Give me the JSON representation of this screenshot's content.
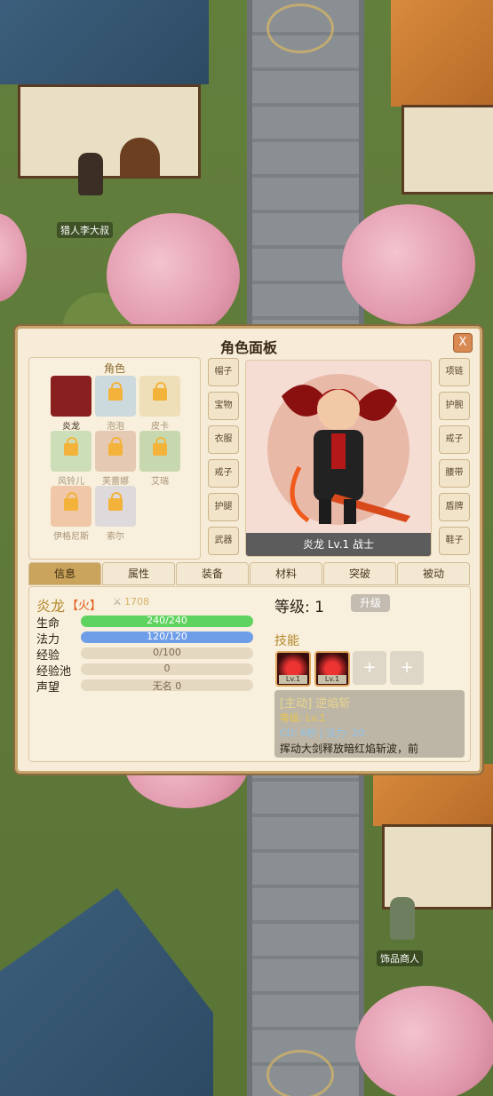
{
  "npcs": {
    "hunter": "猎人李大叔",
    "merchant": "饰品商人"
  },
  "panel": {
    "title": "角色面板",
    "close_label": "X",
    "roster": {
      "title": "角色",
      "heroes": [
        {
          "name": "炎龙",
          "locked": false,
          "color": "#8a1f1f"
        },
        {
          "name": "泡泡",
          "locked": true,
          "color": "#a9c9df"
        },
        {
          "name": "皮卡",
          "locked": true,
          "color": "#e7d19b"
        },
        {
          "name": "风铃儿",
          "locked": true,
          "color": "#a7cf9b"
        },
        {
          "name": "芙蕾娜",
          "locked": true,
          "color": "#d7a98f"
        },
        {
          "name": "艾瑞",
          "locked": true,
          "color": "#9fc48a"
        },
        {
          "name": "伊格尼斯",
          "locked": true,
          "color": "#e9a77b"
        },
        {
          "name": "索尔",
          "locked": true,
          "color": "#c9c7d9"
        }
      ]
    },
    "left_slots": [
      "帽子",
      "宝物",
      "衣服",
      "戒子",
      "护腿",
      "武器"
    ],
    "right_slots": [
      "项链",
      "护腕",
      "戒子",
      "腰带",
      "盾牌",
      "鞋子"
    ],
    "portrait": {
      "name_bar": "炎龙  Lv.1 战士"
    },
    "tabs": [
      "信息",
      "属性",
      "装备",
      "材料",
      "突破",
      "被动"
    ],
    "info": {
      "name": "炎龙",
      "element": "【火】",
      "power": "1708",
      "level_label": "等级: 1",
      "upgrade_button": "升级",
      "stats": [
        {
          "label": "生命",
          "text": "240/240",
          "fill": 1.0,
          "color": "#5fd35f"
        },
        {
          "label": "法力",
          "text": "120/120",
          "fill": 1.0,
          "color": "#6f9ee8"
        },
        {
          "label": "经验",
          "text": "0/100",
          "fill": 0.0,
          "color": "#caa45c"
        },
        {
          "label": "经验池",
          "text": "0",
          "fill": 0.0,
          "color": "#caa45c"
        },
        {
          "label": "声望",
          "text": "无名  0",
          "fill": 0.0,
          "color": "#caa45c"
        }
      ],
      "skills_title": "技能",
      "skill_lv": [
        "Lv.1",
        "Lv.1"
      ],
      "skill_empty": [
        "+",
        "+"
      ],
      "skill_detail": {
        "name": "[主动] 逆焰斩",
        "level": "等级: Lv.1",
        "cd": "CD: 6秒  | 法力: 20",
        "desc": "挥动大剑释放暗红焰斩波，前"
      }
    }
  }
}
